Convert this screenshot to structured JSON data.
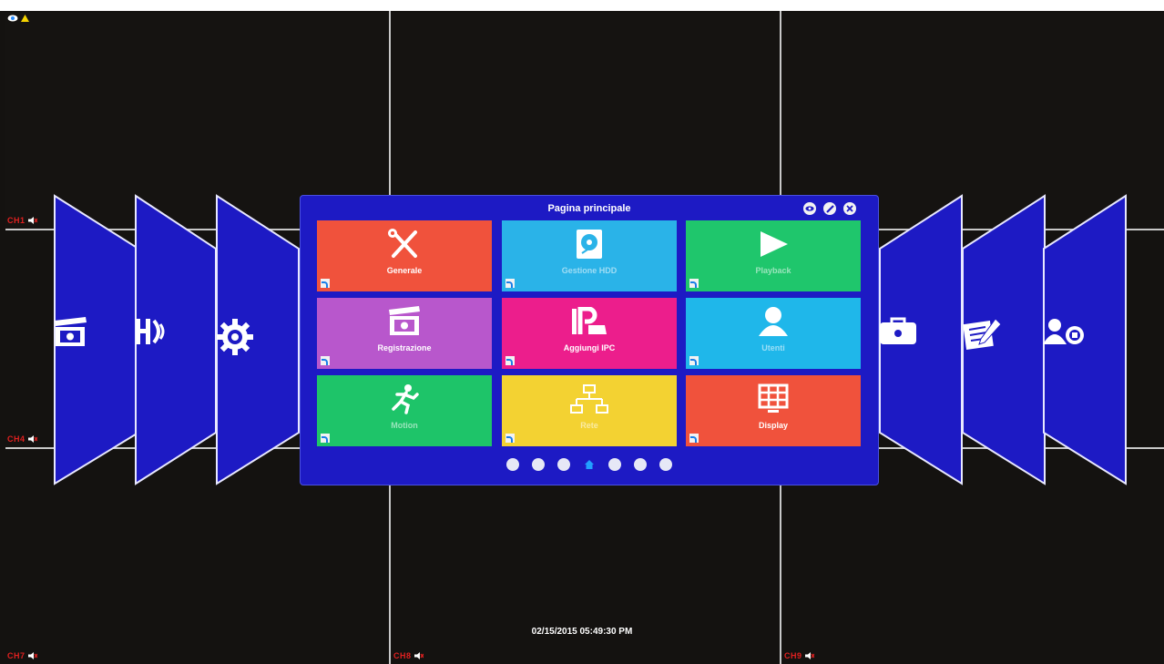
{
  "menu": {
    "title": "Pagina principale",
    "tiles": [
      {
        "label": "Generale",
        "icon": "tools-icon",
        "color": "#f0523c",
        "dim": false
      },
      {
        "label": "Gestione HDD",
        "icon": "hdd-icon",
        "color": "#2ab3e8",
        "dim": true
      },
      {
        "label": "Playback",
        "icon": "play-icon",
        "color": "#1fc66c",
        "dim": true
      },
      {
        "label": "Registrazione",
        "icon": "clapper-icon",
        "color": "#b857cc",
        "dim": false
      },
      {
        "label": "Aggiungi IPC",
        "icon": "ip-camera-icon",
        "color": "#ec1e8c",
        "dim": false
      },
      {
        "label": "Utenti",
        "icon": "user-icon",
        "color": "#1fb7ea",
        "dim": true
      },
      {
        "label": "Motion",
        "icon": "runner-icon",
        "color": "#1ec469",
        "dim": true
      },
      {
        "label": "Rete",
        "icon": "network-icon",
        "color": "#f3d232",
        "dim": true
      },
      {
        "label": "Display",
        "icon": "display-grid-icon",
        "color": "#f0523c",
        "dim": false
      }
    ]
  },
  "channels": {
    "ch1": "CH1",
    "ch4": "CH4",
    "ch7": "CH7",
    "ch8": "CH8",
    "ch9": "CH9"
  },
  "datetime": "02/15/2015 05:49:30 PM",
  "colors": {
    "menu_bg": "#1d1ac4",
    "panel_bg": "#1d1ac4",
    "channel_label": "#e02020"
  }
}
